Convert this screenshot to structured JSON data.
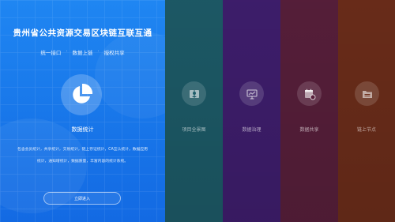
{
  "featured": {
    "title": "贵州省公共资源交易区块链互联互通",
    "tags": [
      "统一接口",
      "数据上链",
      "授权共享"
    ],
    "separator": "·",
    "icon": "pie-chart-icon",
    "name": "数据统计",
    "description": "包含会员统计，共享统计，交易统计，链上存证统计，CA互认统计，数据应用统计，通知增统计，数据质量，丰富内容的统计系统。",
    "button_label": "立即进入"
  },
  "panels": [
    {
      "label": "项目全景图",
      "icon": "book-person-icon",
      "color": "#1d5b68"
    },
    {
      "label": "数据治理",
      "icon": "presentation-chart-icon",
      "color": "#3f1e6e"
    },
    {
      "label": "数据共享",
      "icon": "calendar-share-icon",
      "color": "#581f3b"
    },
    {
      "label": "链上节点",
      "icon": "folder-icon",
      "color": "#6c2d1a"
    }
  ]
}
